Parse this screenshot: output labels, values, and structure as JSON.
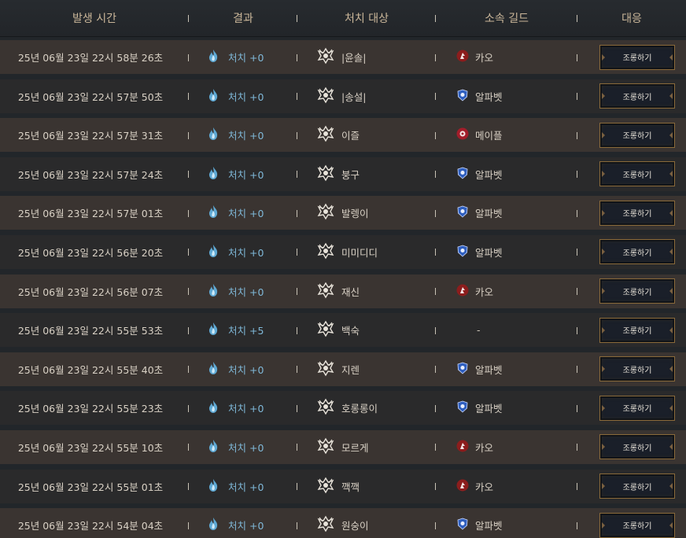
{
  "header": {
    "time": "발생 시간",
    "result": "결과",
    "target": "처치 대상",
    "guild": "소속 길드",
    "action": "대응"
  },
  "colors": {
    "header_text": "#cbb79a",
    "result_blue": "#7fb8d8",
    "row_odd": "#3a3431",
    "row_even": "#2a2a2b",
    "button_border": "#8a6a3a"
  },
  "rows": [
    {
      "time": "25년 06월 23일 22시 58분 26초",
      "result": "처치 +0",
      "target": "|윤솔|",
      "guild": "카오",
      "guild_icon": "red-guild-icon",
      "action": "조롱하기"
    },
    {
      "time": "25년 06월 23일 22시 57분 50초",
      "result": "처치 +0",
      "target": "|송설|",
      "guild": "알파벳",
      "guild_icon": "blue-guild-icon",
      "action": "조롱하기"
    },
    {
      "time": "25년 06월 23일 22시 57분 31초",
      "result": "처치 +0",
      "target": "이즐",
      "guild": "메이플",
      "guild_icon": "maple-guild-icon",
      "action": "조롱하기"
    },
    {
      "time": "25년 06월 23일 22시 57분 24초",
      "result": "처치 +0",
      "target": "붕구",
      "guild": "알파벳",
      "guild_icon": "blue-guild-icon",
      "action": "조롱하기"
    },
    {
      "time": "25년 06월 23일 22시 57분 01초",
      "result": "처치 +0",
      "target": "발렝이",
      "guild": "알파벳",
      "guild_icon": "blue-guild-icon",
      "action": "조롱하기"
    },
    {
      "time": "25년 06월 23일 22시 56분 20초",
      "result": "처치 +0",
      "target": "미미디디",
      "guild": "알파벳",
      "guild_icon": "blue-guild-icon",
      "action": "조롱하기"
    },
    {
      "time": "25년 06월 23일 22시 56분 07초",
      "result": "처치 +0",
      "target": "재신",
      "guild": "카오",
      "guild_icon": "red-guild-icon",
      "action": "조롱하기"
    },
    {
      "time": "25년 06월 23일 22시 55분 53초",
      "result": "처치 +5",
      "target": "백숙",
      "guild": "-",
      "guild_icon": "",
      "action": "조롱하기"
    },
    {
      "time": "25년 06월 23일 22시 55분 40초",
      "result": "처치 +0",
      "target": "지렌",
      "guild": "알파벳",
      "guild_icon": "blue-guild-icon",
      "action": "조롱하기"
    },
    {
      "time": "25년 06월 23일 22시 55분 23초",
      "result": "처치 +0",
      "target": "호롱롱이",
      "guild": "알파벳",
      "guild_icon": "blue-guild-icon",
      "action": "조롱하기"
    },
    {
      "time": "25년 06월 23일 22시 55분 10초",
      "result": "처치 +0",
      "target": "모르게",
      "guild": "카오",
      "guild_icon": "red-guild-icon",
      "action": "조롱하기"
    },
    {
      "time": "25년 06월 23일 22시 55분 01초",
      "result": "처치 +0",
      "target": "깩깩",
      "guild": "카오",
      "guild_icon": "red-guild-icon",
      "action": "조롱하기"
    },
    {
      "time": "25년 06월 23일 22시 54분 04초",
      "result": "처치 +0",
      "target": "원숭이",
      "guild": "알파벳",
      "guild_icon": "blue-guild-icon",
      "action": "조롱하기"
    }
  ]
}
